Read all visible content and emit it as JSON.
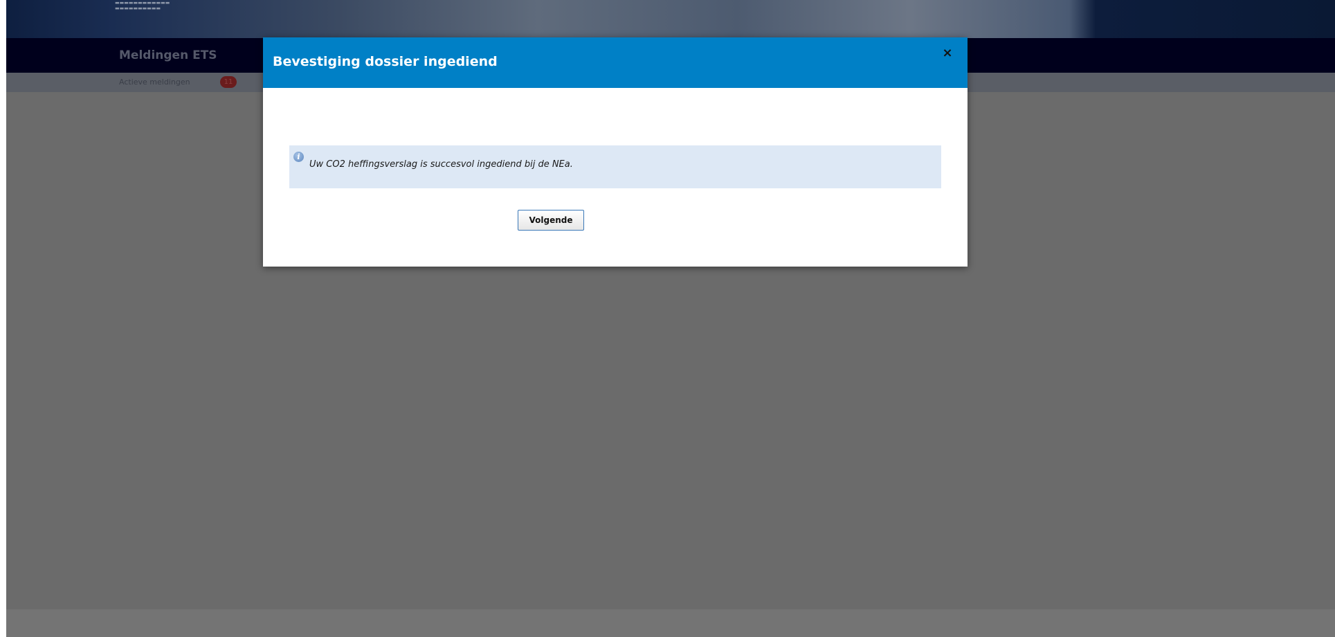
{
  "background": {
    "nav_title": "Meldingen ETS",
    "subnav_link": "Actieve meldingen",
    "badge_count": "11"
  },
  "modal": {
    "title": "Bevestiging dossier ingediend",
    "close_symbol": "×",
    "info_message": "Uw CO2 heffingsverslag is succesvol ingediend bij de NEa.",
    "info_icon_glyph": "i",
    "next_button_label": "Volgende"
  },
  "colors": {
    "modal_header": "#0080c6",
    "overlay": "#6b6b6b",
    "info_box": "#dde8f5"
  }
}
